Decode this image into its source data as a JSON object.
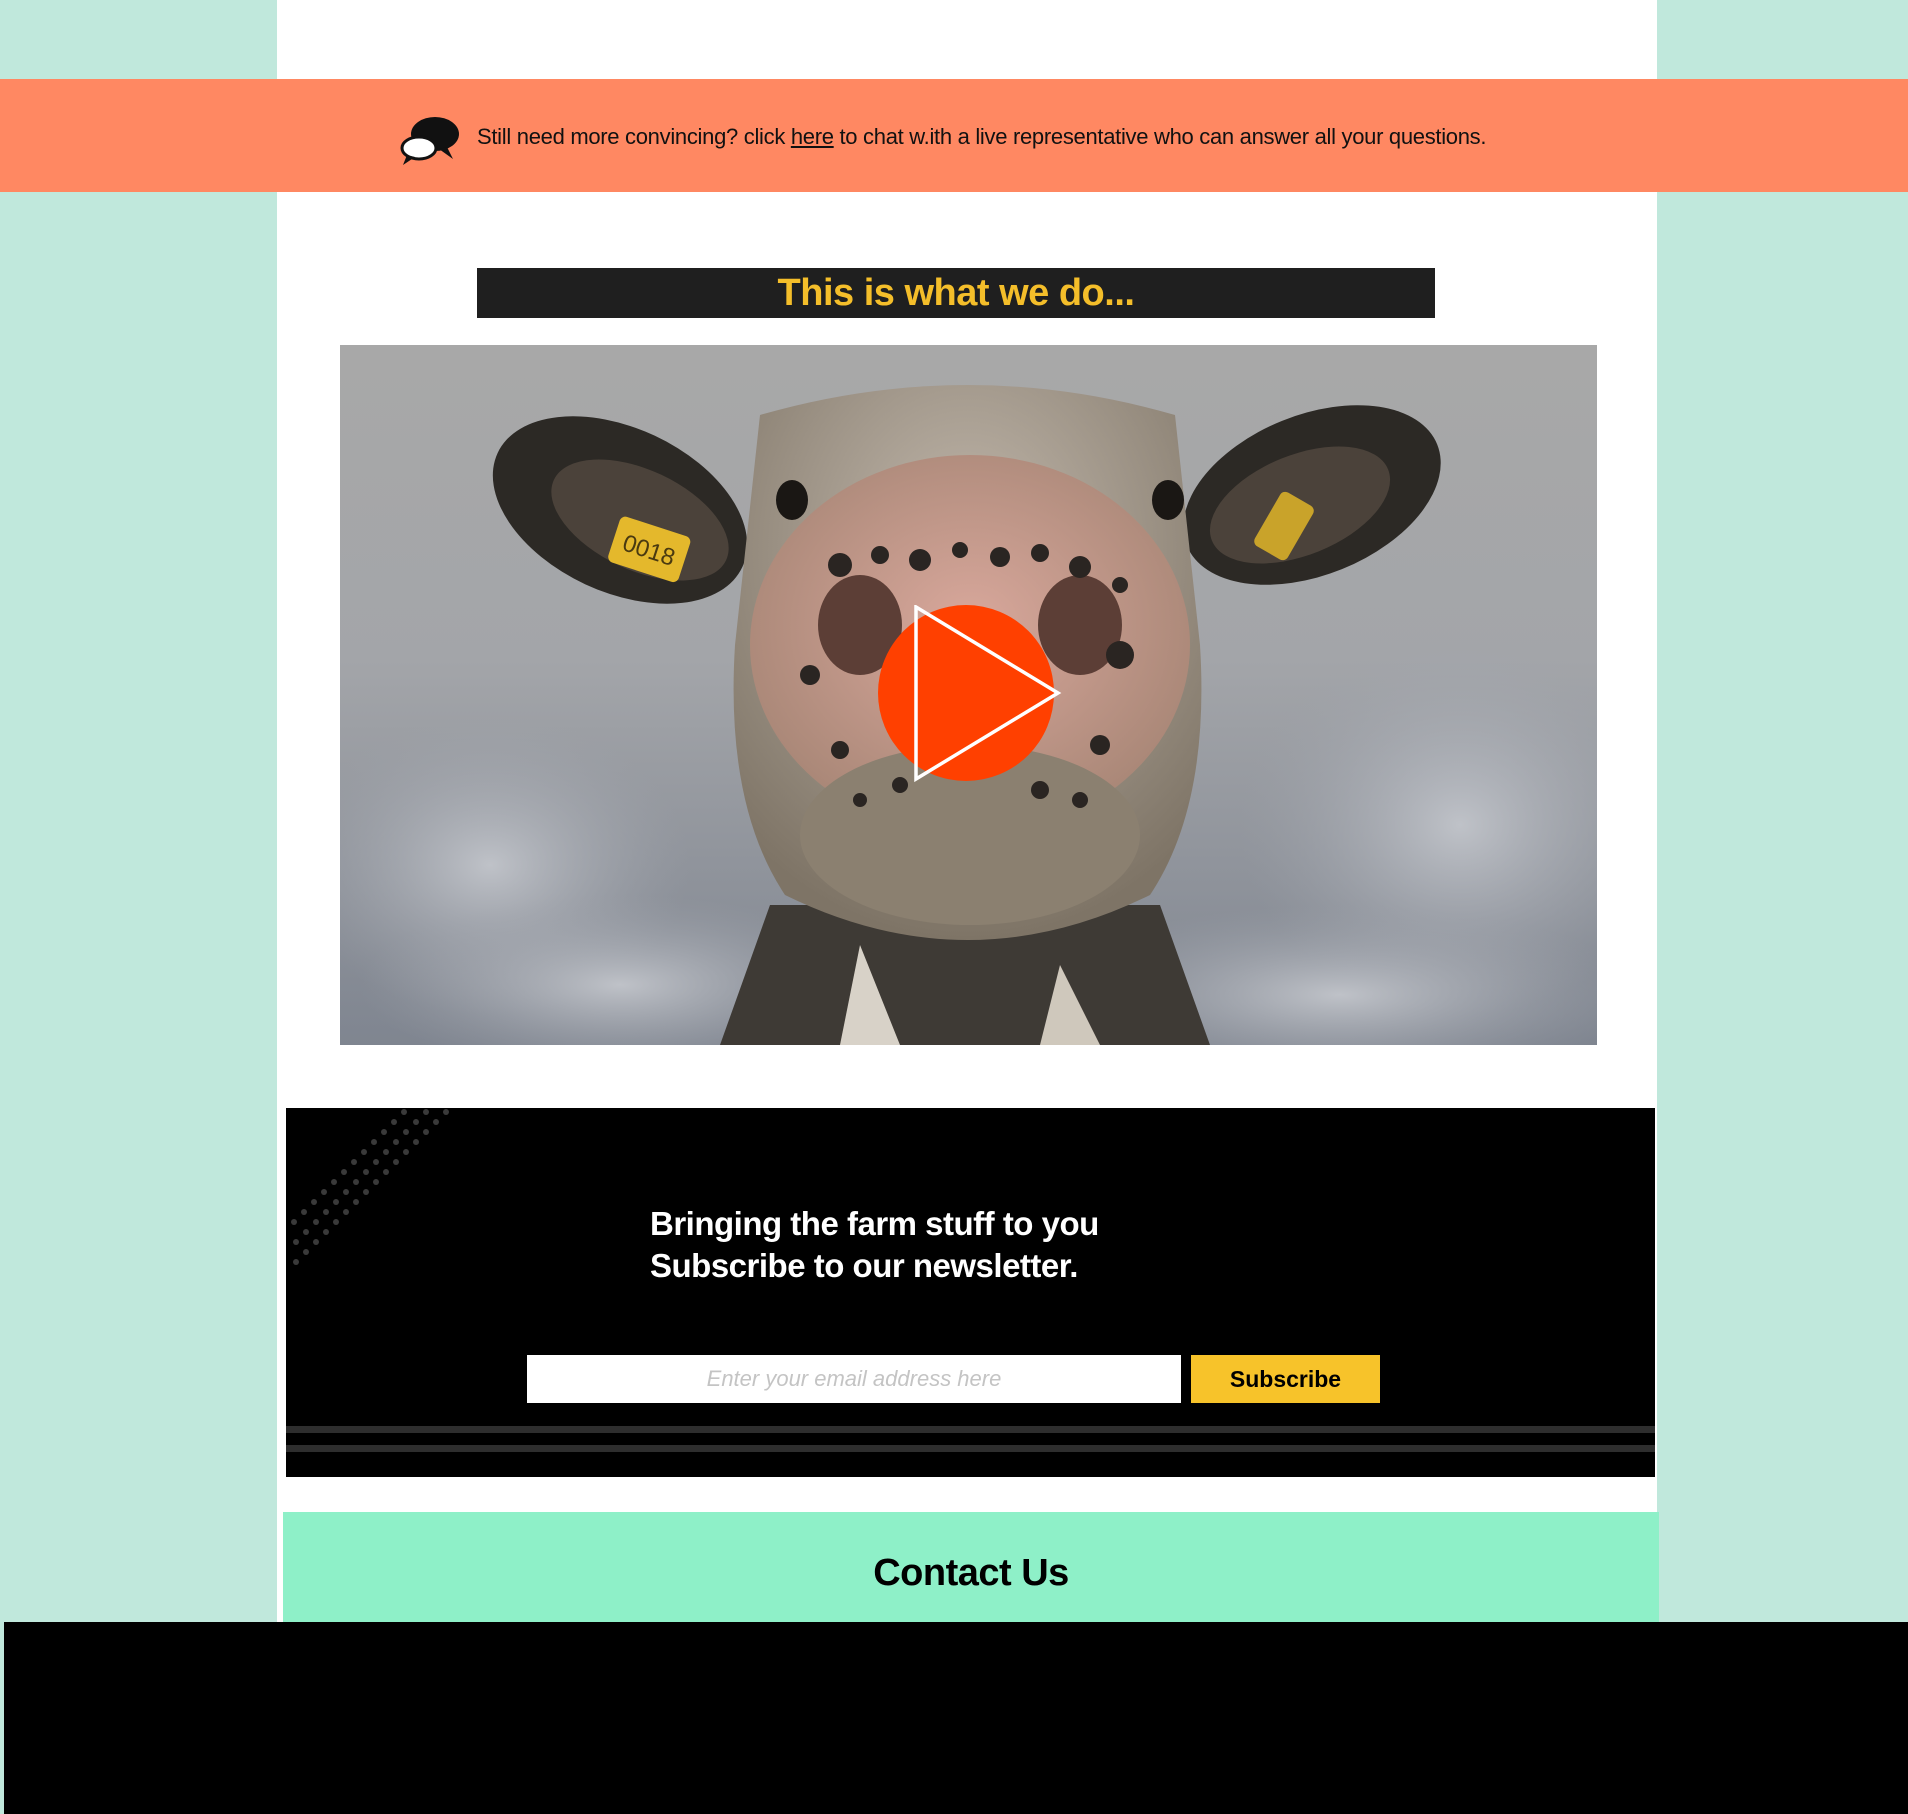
{
  "banner": {
    "icon": "chat-bubbles-icon",
    "text_before": "Still need more convincing? click ",
    "link_text": "here",
    "text_after": " to chat w.ith a live representative who can answer all your questions.",
    "color": "#ff8862"
  },
  "video_section": {
    "title": "This is what we do...",
    "title_color": "#f4be2a",
    "play_icon": "play-icon",
    "play_color": "#ff4000",
    "ear_tag": "0018"
  },
  "newsletter": {
    "line1": "Bringing the farm stuff to you",
    "line2": "Subscribe to our newsletter.",
    "email_placeholder": "Enter your email address here",
    "subscribe_label": "Subscribe",
    "button_color": "#f7c32a"
  },
  "contact": {
    "title": "Contact Us",
    "color": "#8ef0c8"
  }
}
